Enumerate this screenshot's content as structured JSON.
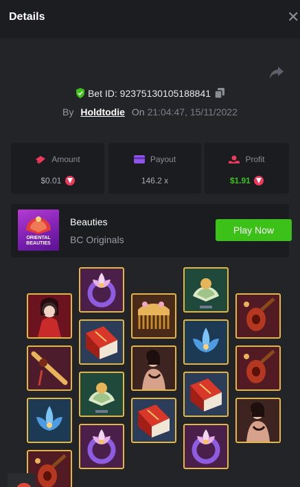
{
  "header": {
    "title": "Details"
  },
  "bet": {
    "id_label": "Bet ID: 92375130105188841",
    "by_label": "By",
    "username": "Holdtodie",
    "on_label": "On",
    "timestamp": "21:04:47, 15/11/2022"
  },
  "stats": [
    {
      "label": "Amount",
      "value": "$0.01",
      "icon": "cash-icon",
      "value_color": "#a8abb2",
      "currency_icon": true
    },
    {
      "label": "Payout",
      "value": "146.2 x",
      "icon": "card-icon",
      "value_color": "#a8abb2",
      "currency_icon": false
    },
    {
      "label": "Profit",
      "value": "$1.91",
      "icon": "profit-icon",
      "value_color": "#3bc117",
      "currency_icon": true
    }
  ],
  "game": {
    "thumb_text": "ORIENTAL BEAUTIES",
    "name": "Beauties",
    "provider": "BC Originals",
    "play_label": "Play Now"
  },
  "reels": [
    [
      "woman-red",
      "flute",
      "blue-lotus",
      "mandolin"
    ],
    [
      "ring-lotus",
      "red-book",
      "fan-crest",
      "ring-lotus"
    ],
    [
      "comb",
      "woman-pose",
      "red-book"
    ],
    [
      "fan-crest",
      "blue-lotus",
      "red-book",
      "ring-lotus"
    ],
    [
      "mandolin",
      "mandolin",
      "woman-pose"
    ]
  ],
  "colors": {
    "accent_green": "#3bc117",
    "tile_border": "#e5b843",
    "background": "#232427"
  }
}
